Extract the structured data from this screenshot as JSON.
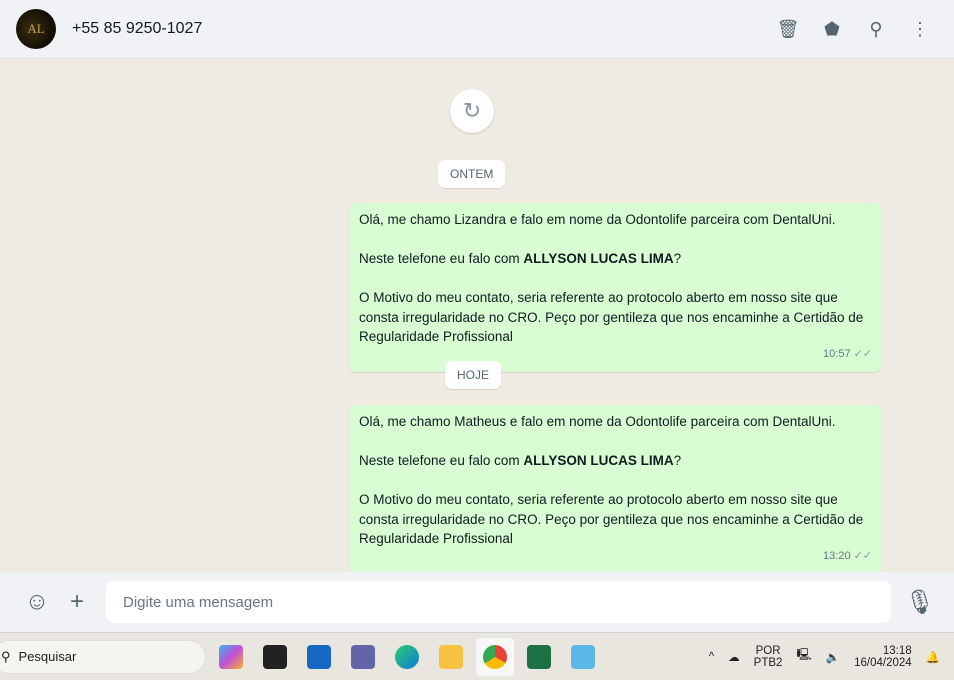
{
  "header": {
    "avatar_initials": "AL",
    "contact": "+55 85 9250-1027",
    "icons": [
      "archive-icon",
      "label-icon",
      "search-icon",
      "menu-icon"
    ]
  },
  "chat": {
    "dates": [
      "ONTEM",
      "HOJE"
    ],
    "messages": [
      {
        "line1": "Olá, me chamo Lizandra e falo em nome da Odontolife parceira com DentalUni.",
        "line2_pre": "Neste telefone eu falo com ",
        "line2_bold": "ALLYSON LUCAS LIMA",
        "line2_post": "?",
        "line3": "O Motivo do meu contato, seria referente ao protocolo aberto em nosso site que consta irregularidade no CRO. Peço por gentileza que nos encaminhe a Certidão de Regularidade Profissional",
        "time": "10:57"
      },
      {
        "line1": "Olá, me chamo Matheus e falo em nome da Odontolife parceira com DentalUni.",
        "line2_pre": "Neste telefone eu falo com ",
        "line2_bold": "ALLYSON LUCAS LIMA",
        "line2_post": "?",
        "line3": "O Motivo do meu contato, seria referente ao protocolo aberto em nosso site que consta irregularidade no CRO. Peço por gentileza que nos encaminhe a Certidão de Regularidade Profissional",
        "time": "13:20"
      }
    ]
  },
  "compose": {
    "placeholder": "Digite uma mensagem"
  },
  "taskbar": {
    "search": "Pesquisar",
    "lang1": "POR",
    "lang2": "PTB2",
    "time": "13:18",
    "date": "16/04/2024"
  }
}
